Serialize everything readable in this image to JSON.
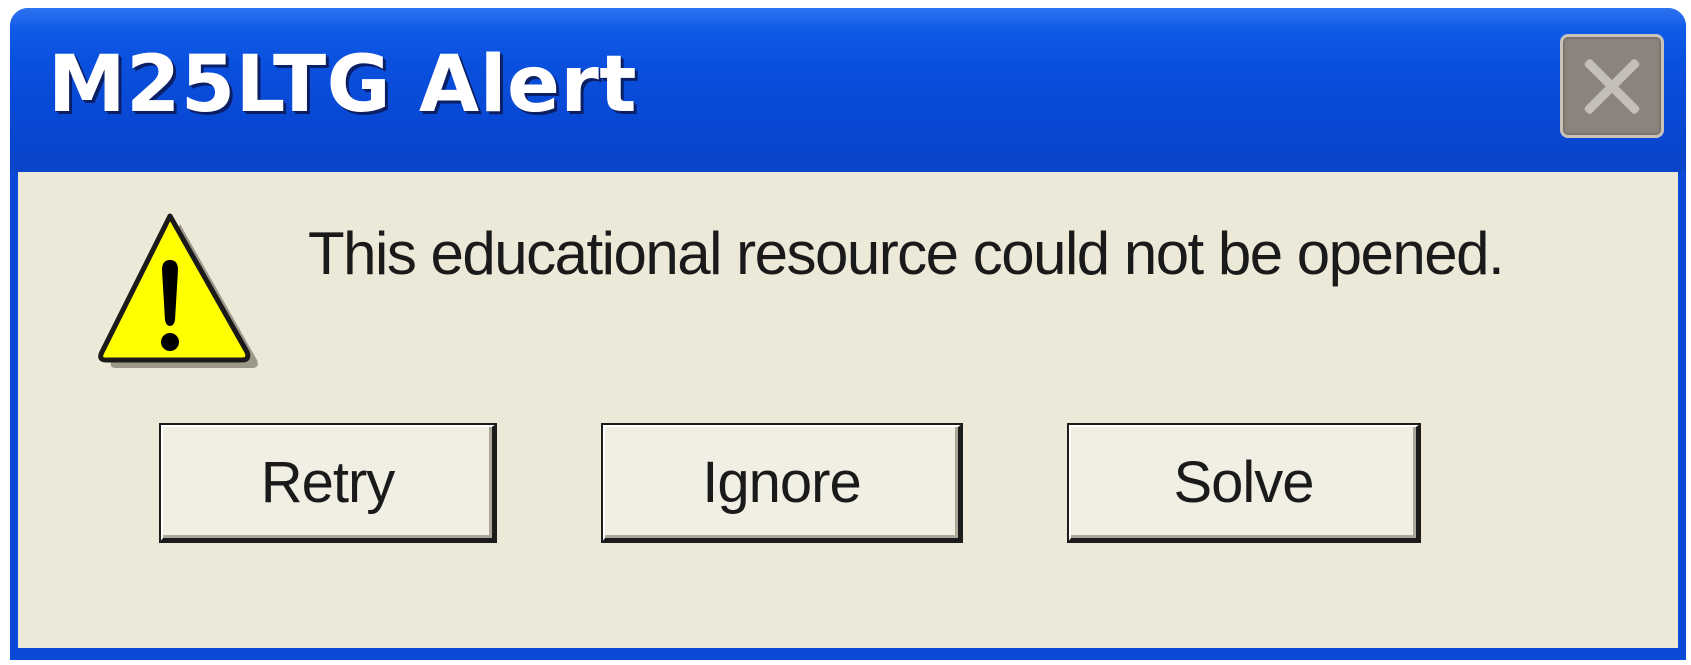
{
  "window": {
    "title": "M25LTG Alert",
    "close_icon": "close-icon"
  },
  "dialog": {
    "icon": "warning-icon",
    "message": "This educational resource could not be opened.",
    "buttons": [
      {
        "label": "Retry"
      },
      {
        "label": "Ignore"
      },
      {
        "label": "Solve"
      }
    ]
  },
  "colors": {
    "titlebar": "#0a4ad6",
    "client_background": "#ece9d8",
    "warning_yellow": "#ffff00",
    "close_button": "#8b847c"
  }
}
